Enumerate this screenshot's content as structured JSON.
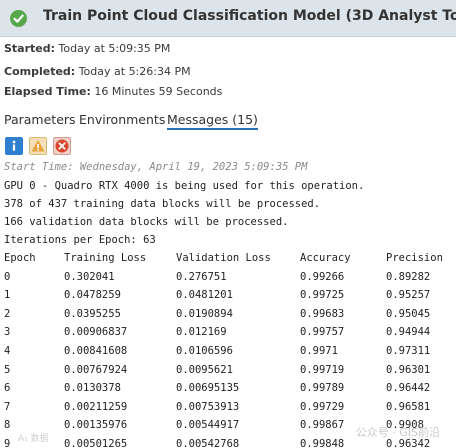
{
  "header": {
    "title": "Train Point Cloud Classification Model (3D Analyst Tools)",
    "status_color": "#57a84a",
    "status_icon": "check-icon"
  },
  "details": {
    "started_label": "Started:",
    "started_value": "Today at 5:09:35 PM",
    "completed_label": "Completed:",
    "completed_value": "Today at 5:26:34 PM",
    "elapsed_label": "Elapsed Time:",
    "elapsed_value": "16 Minutes 59 Seconds"
  },
  "tabs": [
    {
      "label": "Parameters",
      "active": false
    },
    {
      "label": "Environments",
      "active": false
    },
    {
      "label": "Messages (15)",
      "active": true
    }
  ],
  "filters": [
    {
      "name": "info-icon",
      "color": "#2f7fd0"
    },
    {
      "name": "warning-icon",
      "color": "#e8a23a"
    },
    {
      "name": "error-icon",
      "color": "#d9472f"
    }
  ],
  "messages": {
    "start_time": "Start Time: Wednesday, April 19, 2023 5:09:35 PM",
    "lines": [
      "GPU 0 - Quadro RTX 4000 is being used for this operation.",
      "378 of 437 training data blocks will be processed.",
      "166 validation data blocks will be processed.",
      "Iterations per Epoch: 63"
    ]
  },
  "table": {
    "headers": [
      "Epoch",
      "Training Loss",
      "Validation Loss",
      "Accuracy",
      "Precision"
    ],
    "rows": [
      [
        "0",
        "0.302041",
        "0.276751",
        "0.99266",
        "0.89282"
      ],
      [
        "1",
        "0.0478259",
        "0.0481201",
        "0.99725",
        "0.95257"
      ],
      [
        "2",
        "0.0395255",
        "0.0190894",
        "0.99683",
        "0.95045"
      ],
      [
        "3",
        "0.00906837",
        "0.012169",
        "0.99757",
        "0.94944"
      ],
      [
        "4",
        "0.00841608",
        "0.0106596",
        "0.9971",
        "0.97311"
      ],
      [
        "5",
        "0.00767924",
        "0.0095621",
        "0.99719",
        "0.96301"
      ],
      [
        "6",
        "0.0130378",
        "0.00695135",
        "0.99789",
        "0.96442"
      ],
      [
        "7",
        "0.00211259",
        "0.00753913",
        "0.99729",
        "0.96581"
      ],
      [
        "8",
        "0.00135976",
        "0.00544917",
        "0.99867",
        "0.9908"
      ],
      [
        "9",
        "0.00501265",
        "0.00542768",
        "0.99848",
        "0.96342"
      ]
    ]
  },
  "watermark": "公众号 · GIS前沿"
}
